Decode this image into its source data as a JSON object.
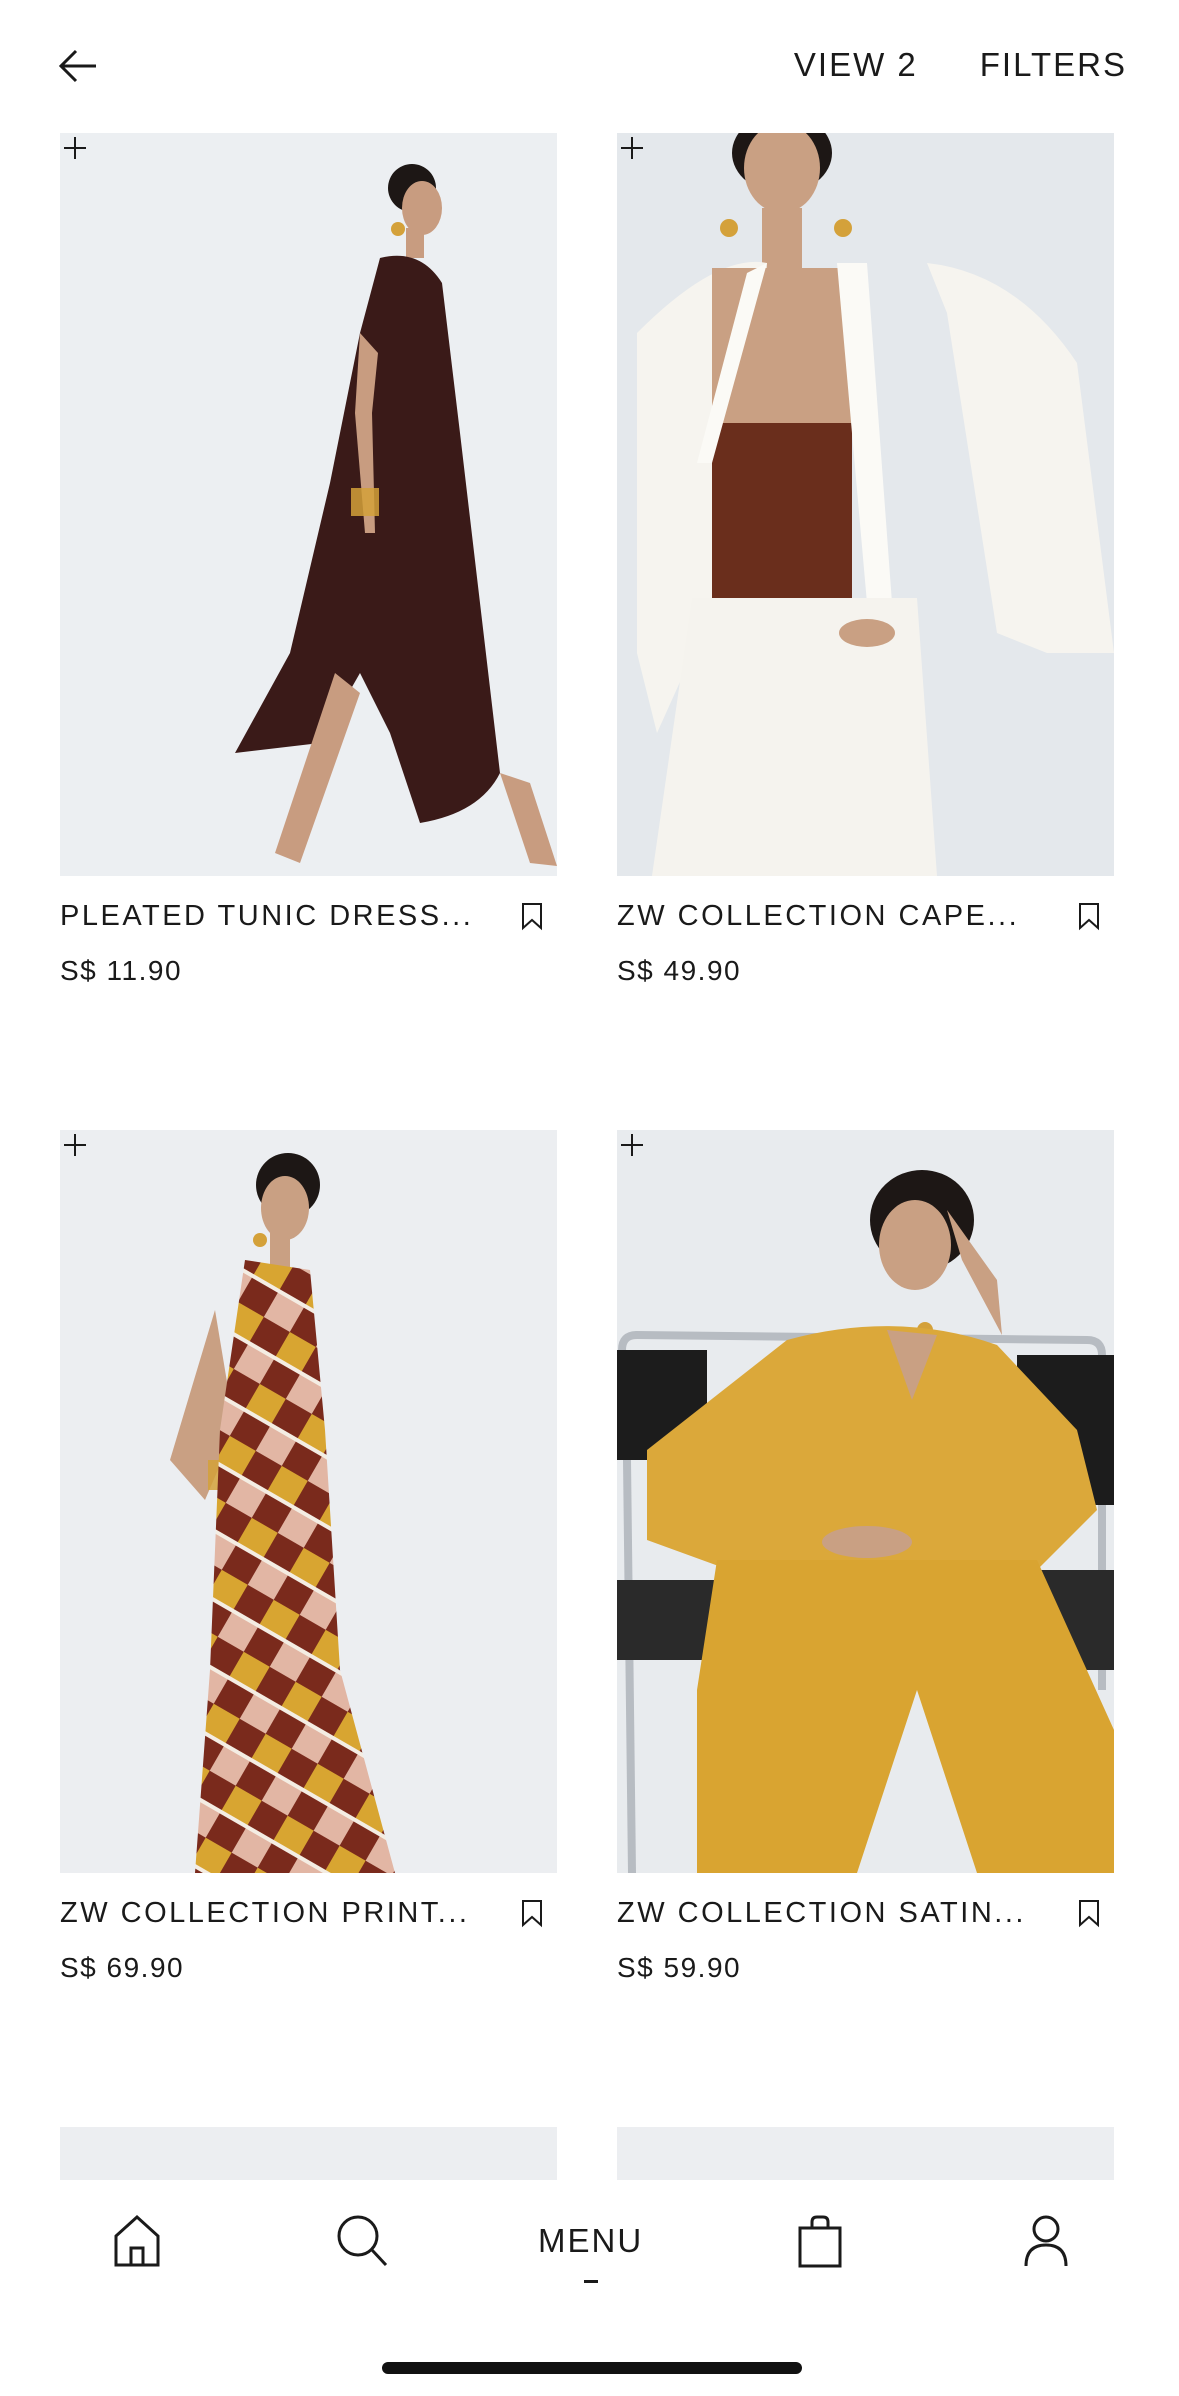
{
  "header": {
    "back_icon": "arrow-left-icon",
    "view_label": "VIEW 2",
    "filters_label": "FILTERS"
  },
  "products": [
    {
      "name": "PLEATED TUNIC DRESS...",
      "price": "S$ 11.90",
      "image_colors": {
        "garment": "#3a1a18",
        "background": "#eceff2"
      }
    },
    {
      "name": "ZW COLLECTION CAPE...",
      "price": "S$ 49.90",
      "image_colors": {
        "garment": "#f4f2ec",
        "top": "#6a2e1c",
        "background": "#e4e8ec"
      }
    },
    {
      "name": "ZW COLLECTION PRINT...",
      "price": "S$ 69.90",
      "image_colors": {
        "garment": "#7a2a1c",
        "accent": "#d8a531",
        "background": "#eceef1"
      }
    },
    {
      "name": "ZW COLLECTION SATIN...",
      "price": "S$ 59.90",
      "image_colors": {
        "garment": "#dba83a",
        "chair": "#1c1c1c",
        "background": "#e8ebee"
      }
    }
  ],
  "bottom_nav": {
    "items": [
      {
        "icon": "home-icon"
      },
      {
        "icon": "search-icon"
      },
      {
        "label": "MENU"
      },
      {
        "icon": "shopping-bag-icon"
      },
      {
        "icon": "user-icon"
      }
    ]
  }
}
